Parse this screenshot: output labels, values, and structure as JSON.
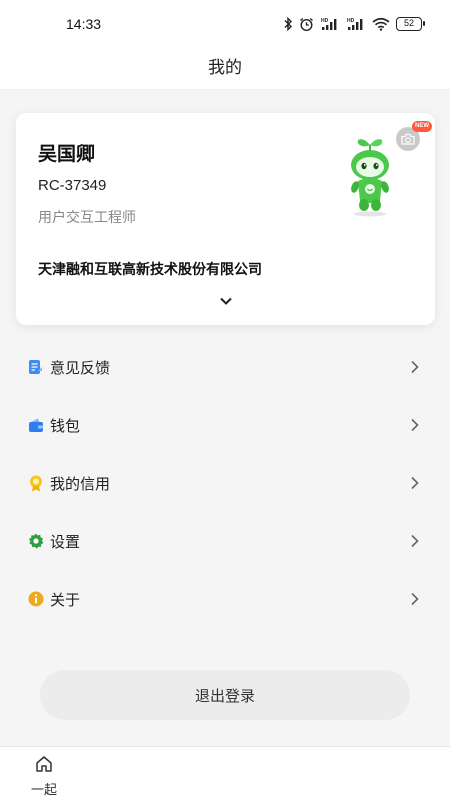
{
  "status_bar": {
    "time": "14:33",
    "battery": "52",
    "icons": [
      "bluetooth-icon",
      "alarm-icon",
      "signal-hd-icon",
      "signal-hd-icon",
      "wifi-icon",
      "battery-icon"
    ]
  },
  "nav": {
    "title": "我的"
  },
  "profile": {
    "name": "吴国卿",
    "id": "RC-37349",
    "job_title": "用户交互工程师",
    "company": "天津融和互联高新技术股份有限公司",
    "new_badge": "NEW",
    "avatar_icon": "sprout-mascot",
    "camera_icon": "camera-icon"
  },
  "menu": {
    "items": [
      {
        "label": "意见反馈",
        "icon": "feedback-icon",
        "color": "#3b8cf5"
      },
      {
        "label": "钱包",
        "icon": "wallet-icon",
        "color": "#2f7ef0"
      },
      {
        "label": "我的信用",
        "icon": "credit-icon",
        "color": "#f5c623"
      },
      {
        "label": "设置",
        "icon": "gear-icon",
        "color": "#2ea043"
      },
      {
        "label": "关于",
        "icon": "info-icon",
        "color": "#f0a81c"
      }
    ]
  },
  "logout": {
    "label": "退出登录"
  },
  "tab_bar": {
    "items": [
      {
        "label": "一起",
        "icon": "home-icon"
      }
    ]
  },
  "colors": {
    "accent": "#3b8cf5",
    "mascot_green": "#4cc94a",
    "badge_red": "#ff5a3c"
  }
}
